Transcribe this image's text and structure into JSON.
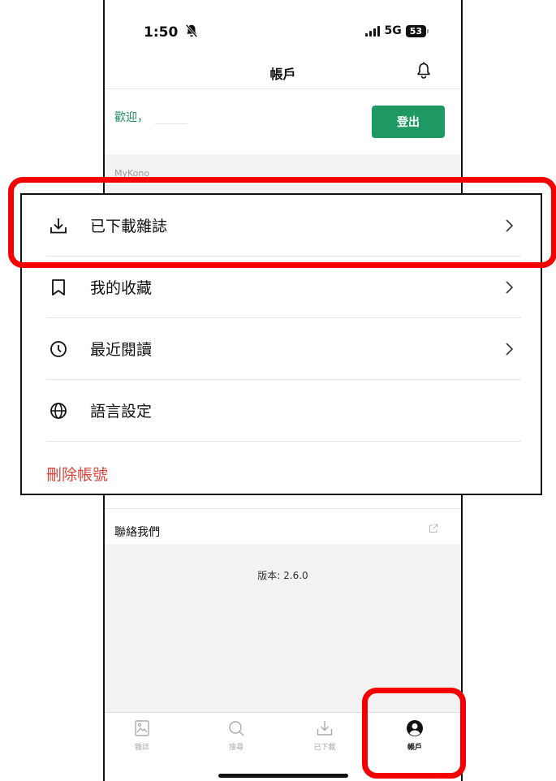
{
  "status_bar": {
    "time": "1:50",
    "network": "5G",
    "battery": "53"
  },
  "nav": {
    "title": "帳戶"
  },
  "welcome": {
    "text": "歡迎，",
    "logout_label": "登出"
  },
  "section": {
    "label": "MyKono"
  },
  "menu": {
    "items": [
      {
        "label": "已下載雜誌",
        "icon": "download-icon",
        "chevron": true
      },
      {
        "label": "我的收藏",
        "icon": "bookmark-icon",
        "chevron": true
      },
      {
        "label": "最近閱讀",
        "icon": "clock-icon",
        "chevron": true
      },
      {
        "label": "語言設定",
        "icon": "globe-icon",
        "chevron": false
      }
    ],
    "delete_label": "刪除帳號"
  },
  "contact": {
    "label": "聯絡我們"
  },
  "version": {
    "text": "版本: 2.6.0"
  },
  "tabs": [
    {
      "label": "雜誌",
      "icon": "magazine-icon",
      "active": false
    },
    {
      "label": "搜尋",
      "icon": "search-icon",
      "active": false
    },
    {
      "label": "已下載",
      "icon": "download-icon",
      "active": false
    },
    {
      "label": "帳戶",
      "icon": "account-icon",
      "active": true
    }
  ],
  "colors": {
    "accent_green": "#1f9963",
    "delete_red": "#d9453a",
    "highlight_red": "#f40000"
  }
}
